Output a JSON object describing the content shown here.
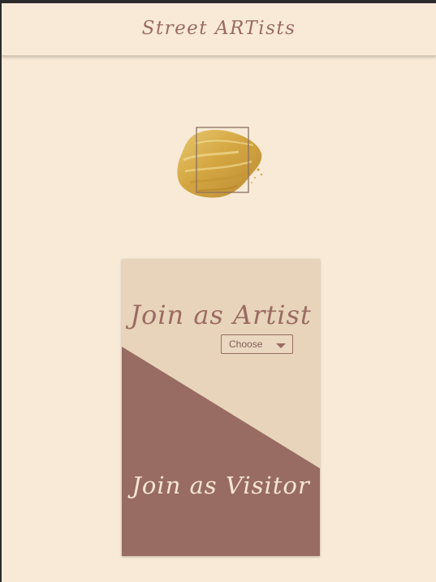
{
  "header": {
    "title": "Street ARTists"
  },
  "logo": {
    "icon": "gold-brushstroke-frame-icon",
    "colors": {
      "gold": "#d4a73a",
      "frame": "#8a6f63"
    }
  },
  "card": {
    "artist": {
      "heading": "Join as Artist",
      "select": {
        "selected": "Choose"
      }
    },
    "visitor": {
      "heading": "Join as Visitor"
    },
    "colors": {
      "top": "#e8d4bb",
      "bottom": "#986c62"
    }
  },
  "theme": {
    "background": "#f8ead7",
    "accent": "#9b6b62"
  }
}
